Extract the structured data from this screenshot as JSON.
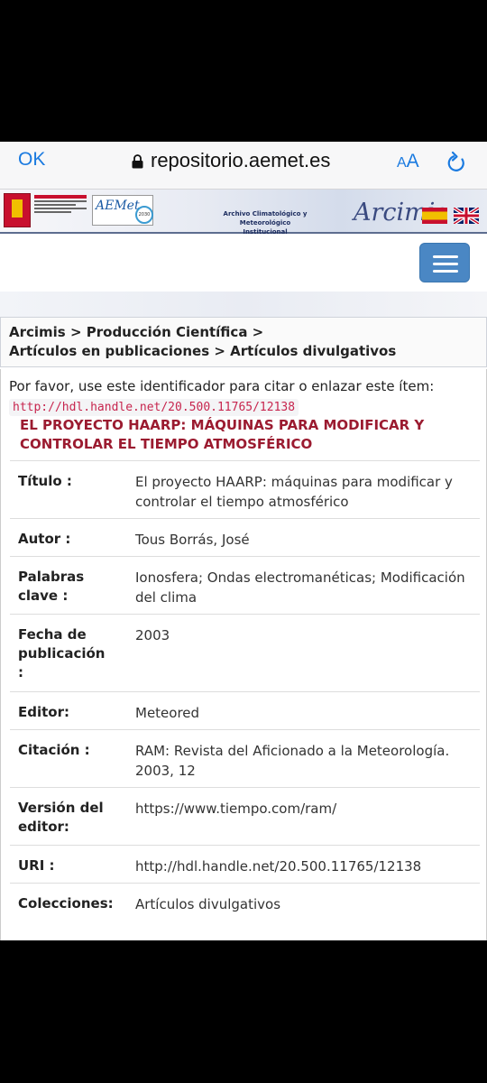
{
  "browser": {
    "ok_label": "OK",
    "url": "repositorio.aemet.es",
    "text_size_small": "A",
    "text_size_large": "A"
  },
  "banner": {
    "aemet_label": "AEMet",
    "archive_line1": "Archivo Climatológico y",
    "archive_line2": "Meteorológico Institucional",
    "arcimis_label": "Arcimis"
  },
  "breadcrumb": {
    "line1": "Arcimis > Producción Científica >",
    "line2": "Artículos en publicaciones > Artículos divulgativos"
  },
  "item": {
    "cite_text": "Por favor, use este identificador para citar o enlazar este ítem:",
    "handle": "http://hdl.handle.net/20.500.11765/12138",
    "title_line1": "EL PROYECTO HAARP: MÁQUINAS PARA MODIFICAR Y",
    "title_line2": "CONTROLAR EL TIEMPO ATMOSFÉRICO"
  },
  "metadata": [
    {
      "k1": "Título :",
      "k2": "",
      "k3": "",
      "v1": "El proyecto HAARP: máquinas para modificar y",
      "v2": "controlar el tiempo atmosférico"
    },
    {
      "k1": "Autor :",
      "k2": "",
      "k3": "",
      "v1": "Tous Borrás, José",
      "v2": ""
    },
    {
      "k1": "Palabras",
      "k2": "clave :",
      "k3": "",
      "v1": "Ionosfera; Ondas electromanéticas; Modificación",
      "v2": "del clima"
    },
    {
      "k1": "Fecha de",
      "k2": "publicación",
      "k3": ":",
      "v1": "2003",
      "v2": ""
    },
    {
      "k1": "Editor:",
      "k2": "",
      "k3": "",
      "v1": "Meteored",
      "v2": ""
    },
    {
      "k1": "Citación :",
      "k2": "",
      "k3": "",
      "v1": "RAM: Revista del Aficionado a la Meteorología.",
      "v2": "2003, 12"
    },
    {
      "k1": "Versión del",
      "k2": "editor:",
      "k3": "",
      "v1": "https://www.tiempo.com/ram/",
      "v2": ""
    },
    {
      "k1": "URI :",
      "k2": "",
      "k3": "",
      "v1": "http://hdl.handle.net/20.500.11765/12138",
      "v2": ""
    },
    {
      "k1": "Colecciones:",
      "k2": "",
      "k3": "",
      "v1": "Artículos divulgativos",
      "v2": ""
    }
  ]
}
